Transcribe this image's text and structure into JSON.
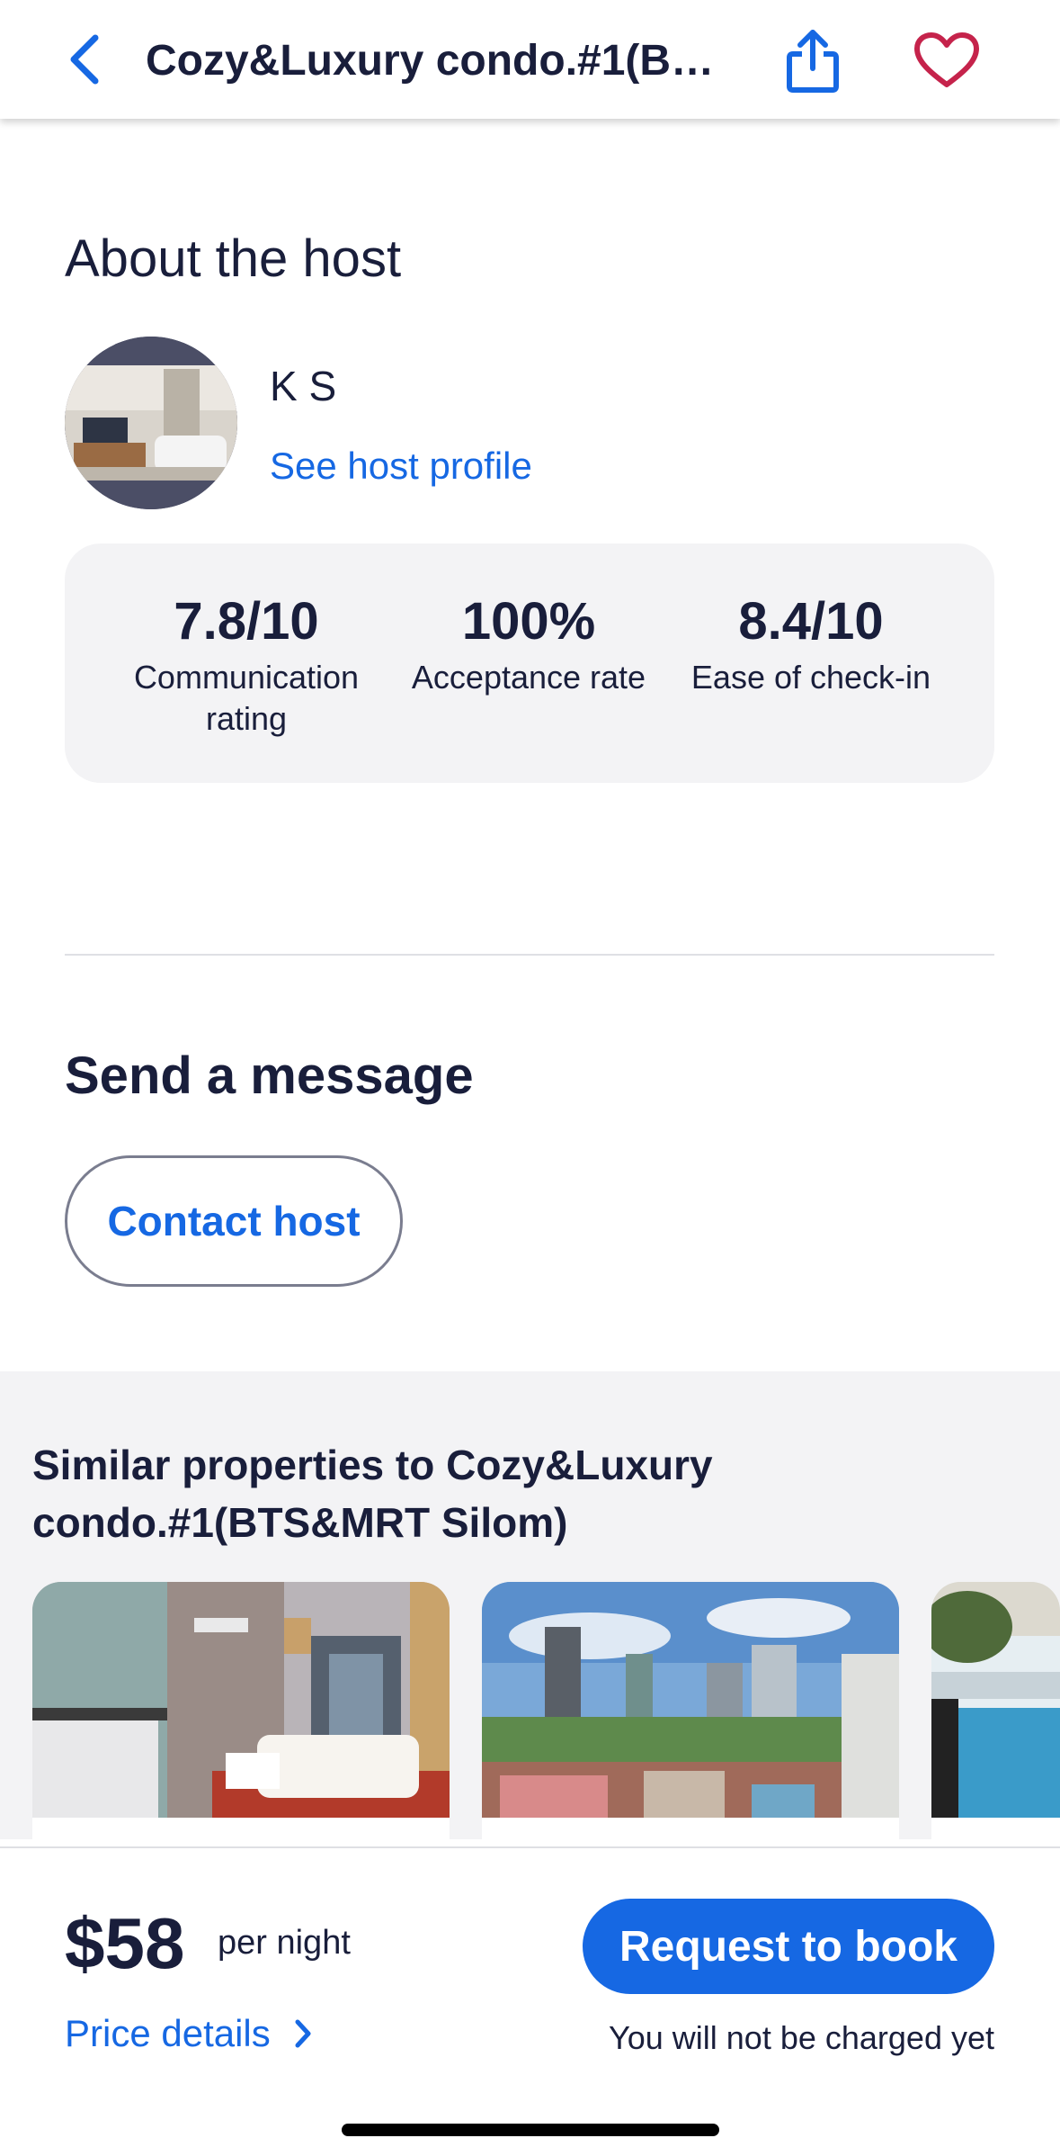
{
  "header": {
    "title": "Cozy&Luxury condo.#1(BTS&MRT Silom)",
    "back_icon": "chevron-left-icon",
    "share_icon": "share-icon",
    "favorite_icon": "heart-icon"
  },
  "about_host": {
    "title": "About the host",
    "host_name": "K S",
    "profile_link": "See host profile",
    "stats": [
      {
        "value": "7.8/10",
        "label": "Communication rating"
      },
      {
        "value": "100%",
        "label": "Acceptance rate"
      },
      {
        "value": "8.4/10",
        "label": "Ease of check-in"
      }
    ]
  },
  "message": {
    "title": "Send a message",
    "contact_button": "Contact host"
  },
  "similar": {
    "title": "Similar properties to Cozy&Luxury condo.#1(BTS&MRT Silom)"
  },
  "booking": {
    "price": "$58",
    "per_night": "per night",
    "price_details": "Price details",
    "book_button": "Request to book",
    "note": "You will not be charged yet"
  },
  "colors": {
    "accent": "#1668e3",
    "text": "#191e3b",
    "heart": "#c5234b"
  }
}
